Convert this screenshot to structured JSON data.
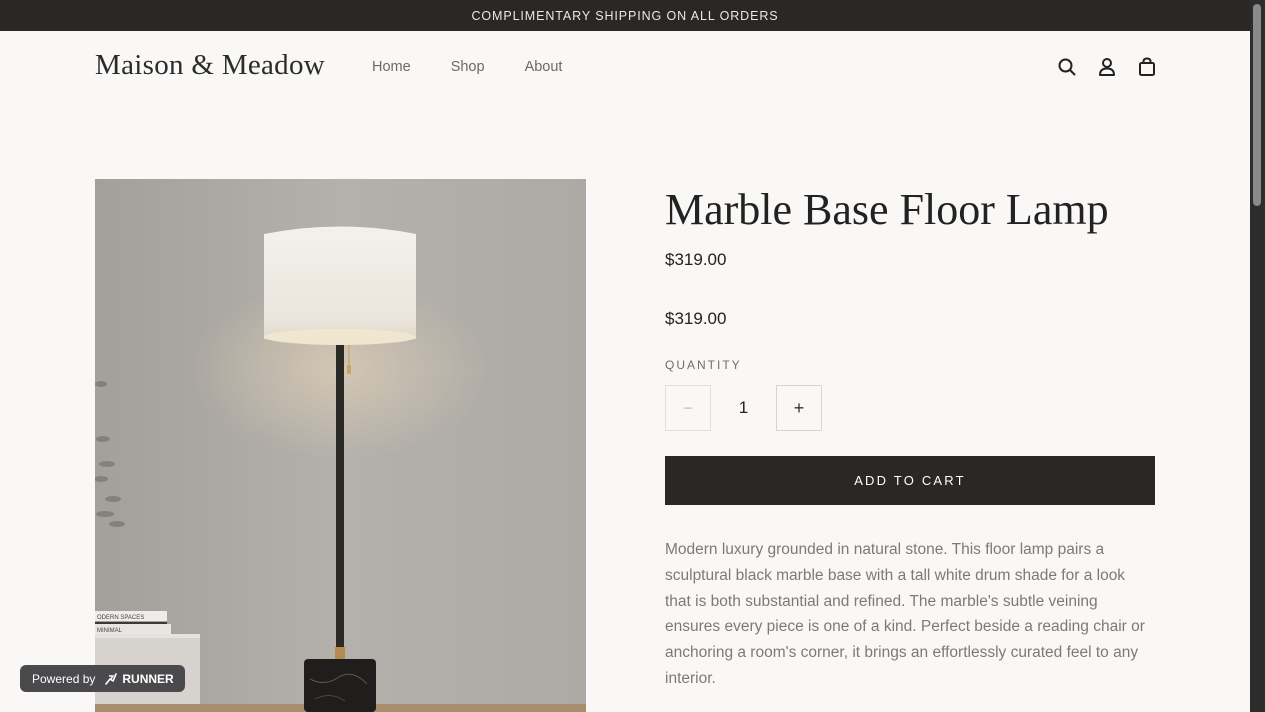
{
  "announcement": "COMPLIMENTARY SHIPPING ON ALL ORDERS",
  "brand": "Maison & Meadow",
  "nav": [
    "Home",
    "Shop",
    "About"
  ],
  "header_icons": [
    "search-icon",
    "account-icon",
    "cart-bag-icon"
  ],
  "product": {
    "title": "Marble Base Floor Lamp",
    "price": "$319.00",
    "price_secondary": "$319.00",
    "quantity_label": "QUANTITY",
    "quantity": "1",
    "decrement_symbol": "−",
    "increment_symbol": "+",
    "add_to_cart": "ADD TO CART",
    "description": "Modern luxury grounded in natural stone. This floor lamp pairs a sculptural black marble base with a tall white drum shade for a look that is both substantial and refined. The marble's subtle veining ensures every piece is one of a kind. Perfect beside a reading chair or anchoring a room's corner, it brings an effortlessly curated feel to any interior."
  },
  "photo_book_spines": [
    "ODERN SPACES",
    "MINIMAL"
  ],
  "badge": {
    "powered_by": "Powered by",
    "runner": "RUNNER"
  },
  "colors": {
    "page_bg": "#faf8f6",
    "announcement_bg": "#2a2724",
    "button_bg": "#2a2724",
    "body_text": "#7c7a77"
  }
}
